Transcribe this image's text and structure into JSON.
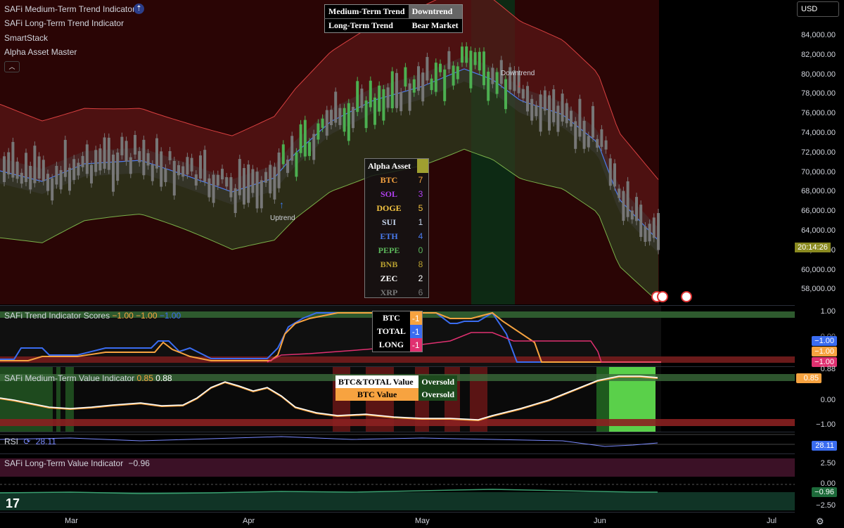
{
  "indicators_main": [
    "SAFi Medium-Term Trend Indicator",
    "SAFi Long-Term Trend Indicator",
    "SmartStack",
    "Alpha Asset Master"
  ],
  "currency": "USD",
  "trend_table": {
    "medium_label": "Medium-Term Trend",
    "medium_value": "Downtrend",
    "long_label": "Long-Term Trend",
    "long_value": "Bear Market"
  },
  "alpha_table": {
    "title": "Alpha Asset",
    "rows": [
      {
        "name": "BTC",
        "value": "7",
        "color": "#f7a340"
      },
      {
        "name": "SOL",
        "value": "3",
        "color": "#b040f0"
      },
      {
        "name": "DOGE",
        "value": "5",
        "color": "#f5c542"
      },
      {
        "name": "SUI",
        "value": "1",
        "color": "#c8d8f0"
      },
      {
        "name": "ETH",
        "value": "4",
        "color": "#4a7cf0"
      },
      {
        "name": "PEPE",
        "value": "0",
        "color": "#5cb85c"
      },
      {
        "name": "BNB",
        "value": "8",
        "color": "#b8a030"
      },
      {
        "name": "ZEC",
        "value": "2",
        "color": "#ffffff"
      },
      {
        "name": "XRP",
        "value": "6",
        "color": "#777777"
      }
    ]
  },
  "annotations": {
    "uptrend": "Uptrend",
    "downtrend": "Downtrend"
  },
  "price_axis": [
    "84,000.00",
    "82,000.00",
    "80,000.00",
    "78,000.00",
    "76,000.00",
    "74,000.00",
    "72,000.00",
    "70,000.00",
    "68,000.00",
    "66,000.00",
    "64,000.00",
    "62,000.00",
    "60,000.00",
    "58,000.00"
  ],
  "countdown": "20:14:26",
  "trend_scores": {
    "label": "SAFi Trend Indicator Scores",
    "v1": "−1.00",
    "v2": "−1.00",
    "v3": "−1.00",
    "axis_top": "1.00",
    "axis_mid": "0.00",
    "badges": [
      "−1.00",
      "−1.00",
      "−1.00"
    ],
    "table": [
      {
        "name": "BTC",
        "value": "-1",
        "color": "#f7a340"
      },
      {
        "name": "TOTAL",
        "value": "-1",
        "color": "#3a6cf0"
      },
      {
        "name": "LONG",
        "value": "-1",
        "color": "#e03070"
      }
    ]
  },
  "medium_value": {
    "label": "SAFi Medium-Term Value Indicator",
    "v1": "0.85",
    "v2": "0.88",
    "axis": [
      "0.88",
      "0.00",
      "−1.00"
    ],
    "badge": "0.85",
    "table": [
      {
        "name": "BTC&TOTAL Value",
        "status": "Oversold"
      },
      {
        "name": "BTC Value",
        "status": "Oversold"
      }
    ]
  },
  "rsi": {
    "label": "RSI",
    "value": "28.11",
    "badge": "28.11"
  },
  "long_value": {
    "label": "SAFi Long-Term Value Indicator",
    "value": "−0.96",
    "axis": [
      "2.50",
      "0.00",
      "−2.50"
    ],
    "badge": "−0.96"
  },
  "months": [
    "Mar",
    "Apr",
    "May",
    "Jun",
    "Jul"
  ]
}
